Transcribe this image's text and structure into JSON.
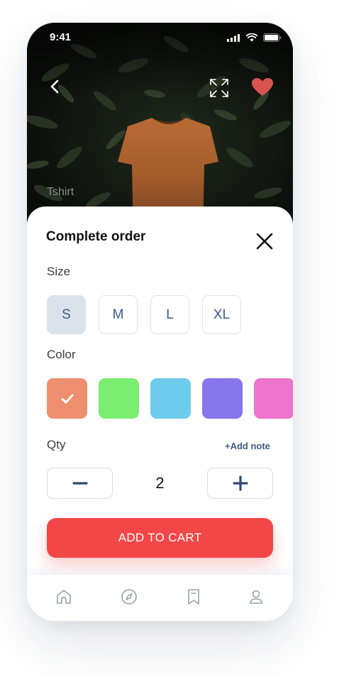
{
  "status_bar": {
    "time": "9:41"
  },
  "hero": {
    "product_label": "Tshirt",
    "icons": [
      "back-arrow-icon",
      "expand-icon",
      "heart-icon"
    ],
    "heart_color": "#d9534f"
  },
  "order_sheet": {
    "title": "Complete order",
    "size": {
      "label": "Size",
      "options": [
        "S",
        "M",
        "L",
        "XL"
      ],
      "selected": "S"
    },
    "color": {
      "label": "Color",
      "swatches": [
        "#ee9070",
        "#79ee71",
        "#6fcbee",
        "#8776ec",
        "#ee74cc"
      ],
      "selected_index": 0
    },
    "quantity": {
      "label": "Qty",
      "add_note": "+Add note",
      "value": "2"
    },
    "add_to_cart": "ADD TO CART",
    "accent_color": "#f34747"
  },
  "bottom_nav": {
    "items": [
      "home-icon",
      "compass-icon",
      "bookmark-icon",
      "profile-icon"
    ]
  }
}
